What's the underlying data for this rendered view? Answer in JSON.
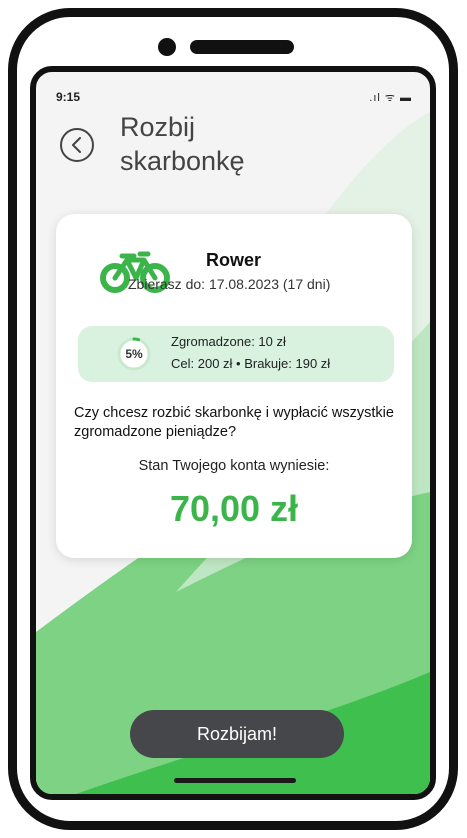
{
  "status_bar": {
    "time": "9:15",
    "icons": ".ıl ᯤ ▬"
  },
  "header": {
    "title": "Rozbij skarbonkę"
  },
  "goal": {
    "name": "Rower",
    "deadline_label": "Zbierasz do:",
    "deadline_value": "17.08.2023 (17 dni)",
    "icon": "bicycle-icon",
    "color": "#3bb54a"
  },
  "progress": {
    "percent_label": "5%",
    "fraction": 0.05,
    "collected": "Zgromadzone: 10 zł",
    "target_line": "Cel: 200 zł • Brakuje: 190 zł"
  },
  "question": "Czy chcesz rozbić skarbonkę i wypłacić wszystkie zgromadzone pieniądze?",
  "balance": {
    "label": "Stan Twojego konta wyniesie:",
    "value": "70,00 zł"
  },
  "actions": {
    "confirm": "Rozbijam!"
  },
  "colors": {
    "accent": "#3bb54a",
    "button": "#45474a"
  }
}
